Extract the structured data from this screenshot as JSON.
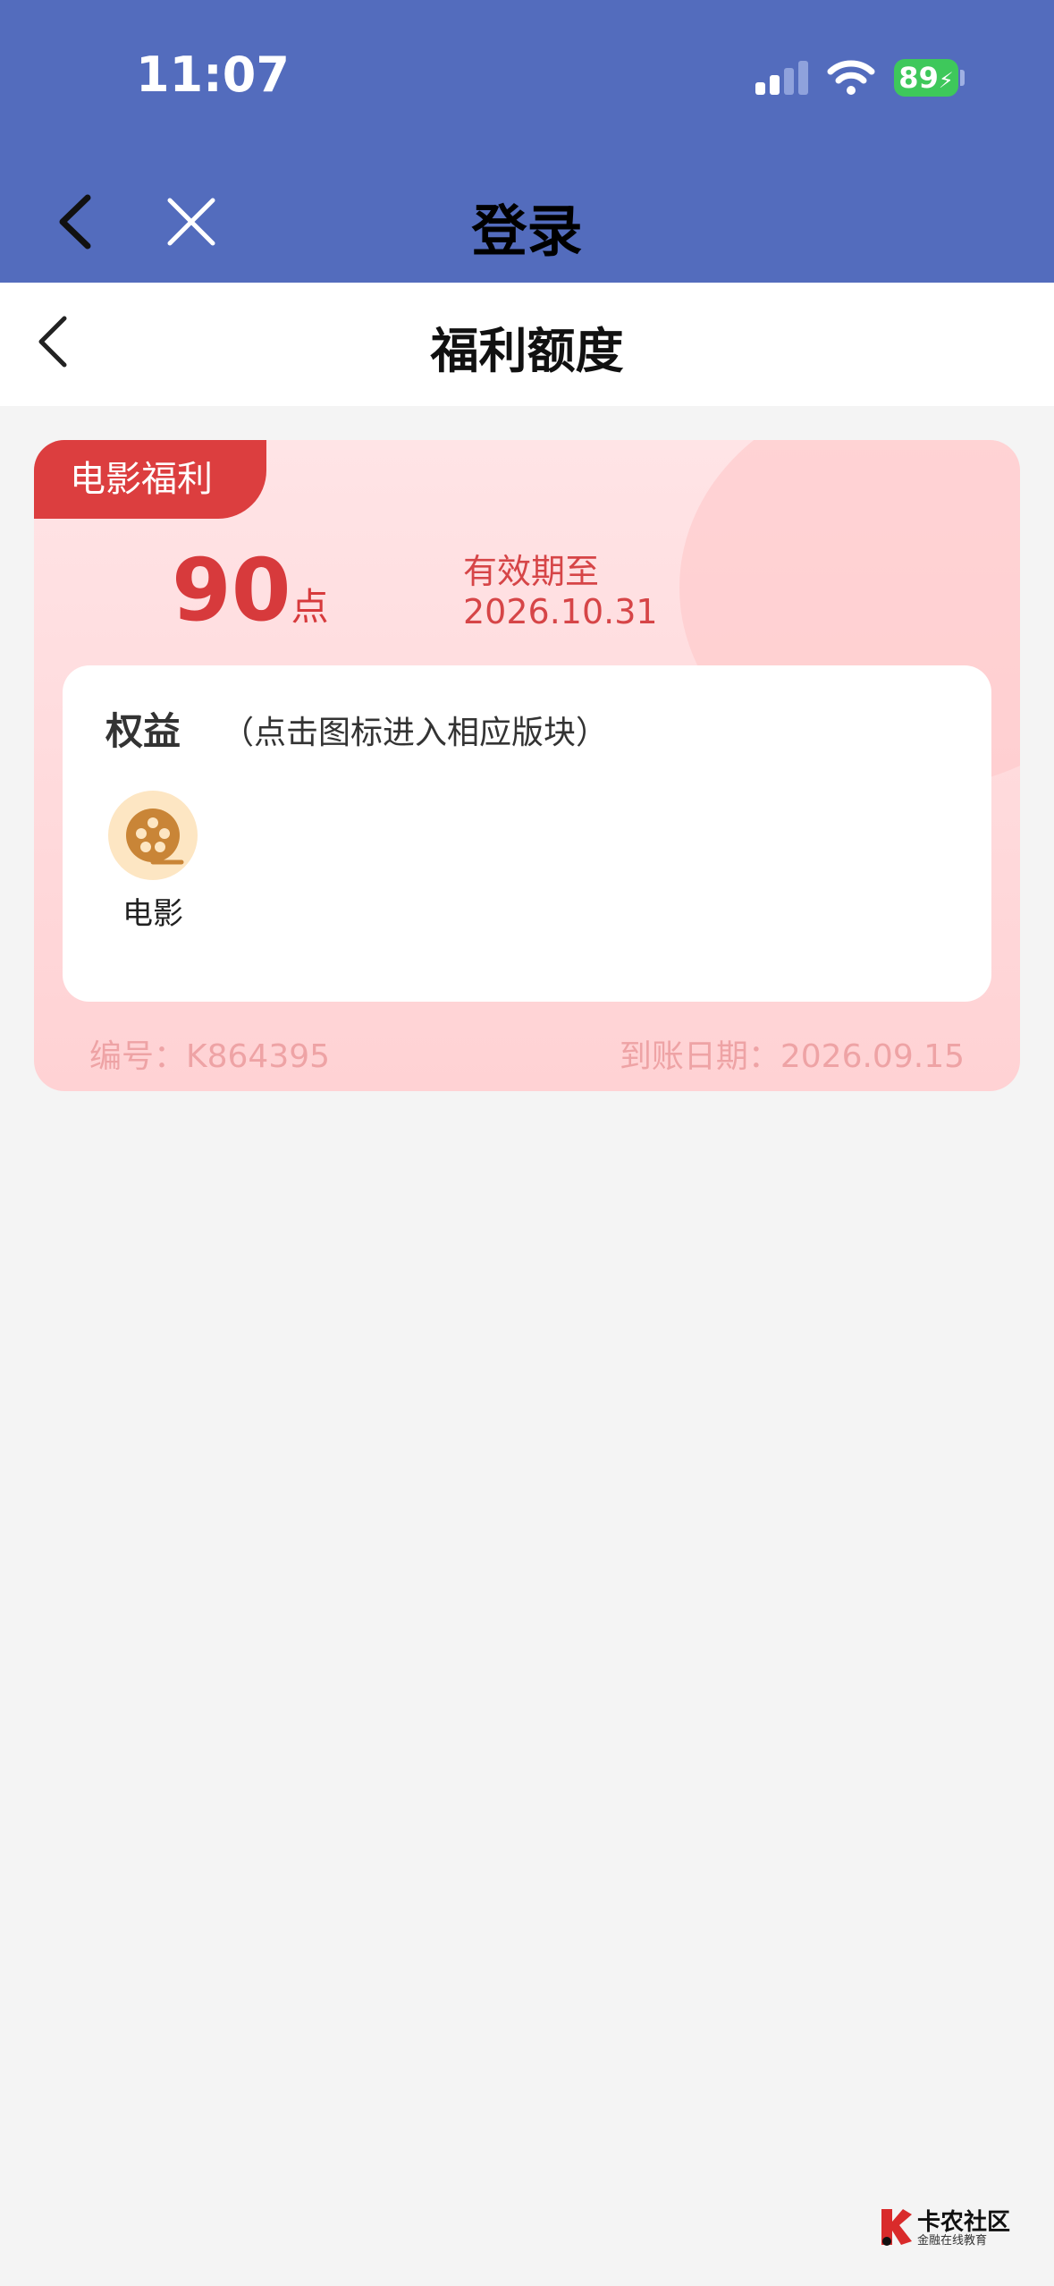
{
  "status": {
    "time": "11:07",
    "battery": "89"
  },
  "nav": {
    "title": "登录"
  },
  "header": {
    "title": "福利额度"
  },
  "card": {
    "tag": "电影福利",
    "points": "90",
    "points_unit": "点",
    "expiry_label": "有效期至",
    "expiry_date": "2026.10.31",
    "rights_title": "权益",
    "rights_hint": "（点击图标进入相应版块）",
    "movie_label": "电影",
    "code": "编号：K864395",
    "arrival_date": "到账日期：2026.09.15"
  },
  "watermark": {
    "brand": "卡农社区",
    "slogan": "金融在线教育"
  },
  "colors": {
    "nav_bg": "#536cbd",
    "accent": "#dc3e3f",
    "card_bg": "#ffd9db"
  },
  "icons": [
    "back-arrow-icon",
    "close-icon",
    "wifi-icon",
    "signal-icon",
    "movie-reel-icon"
  ]
}
